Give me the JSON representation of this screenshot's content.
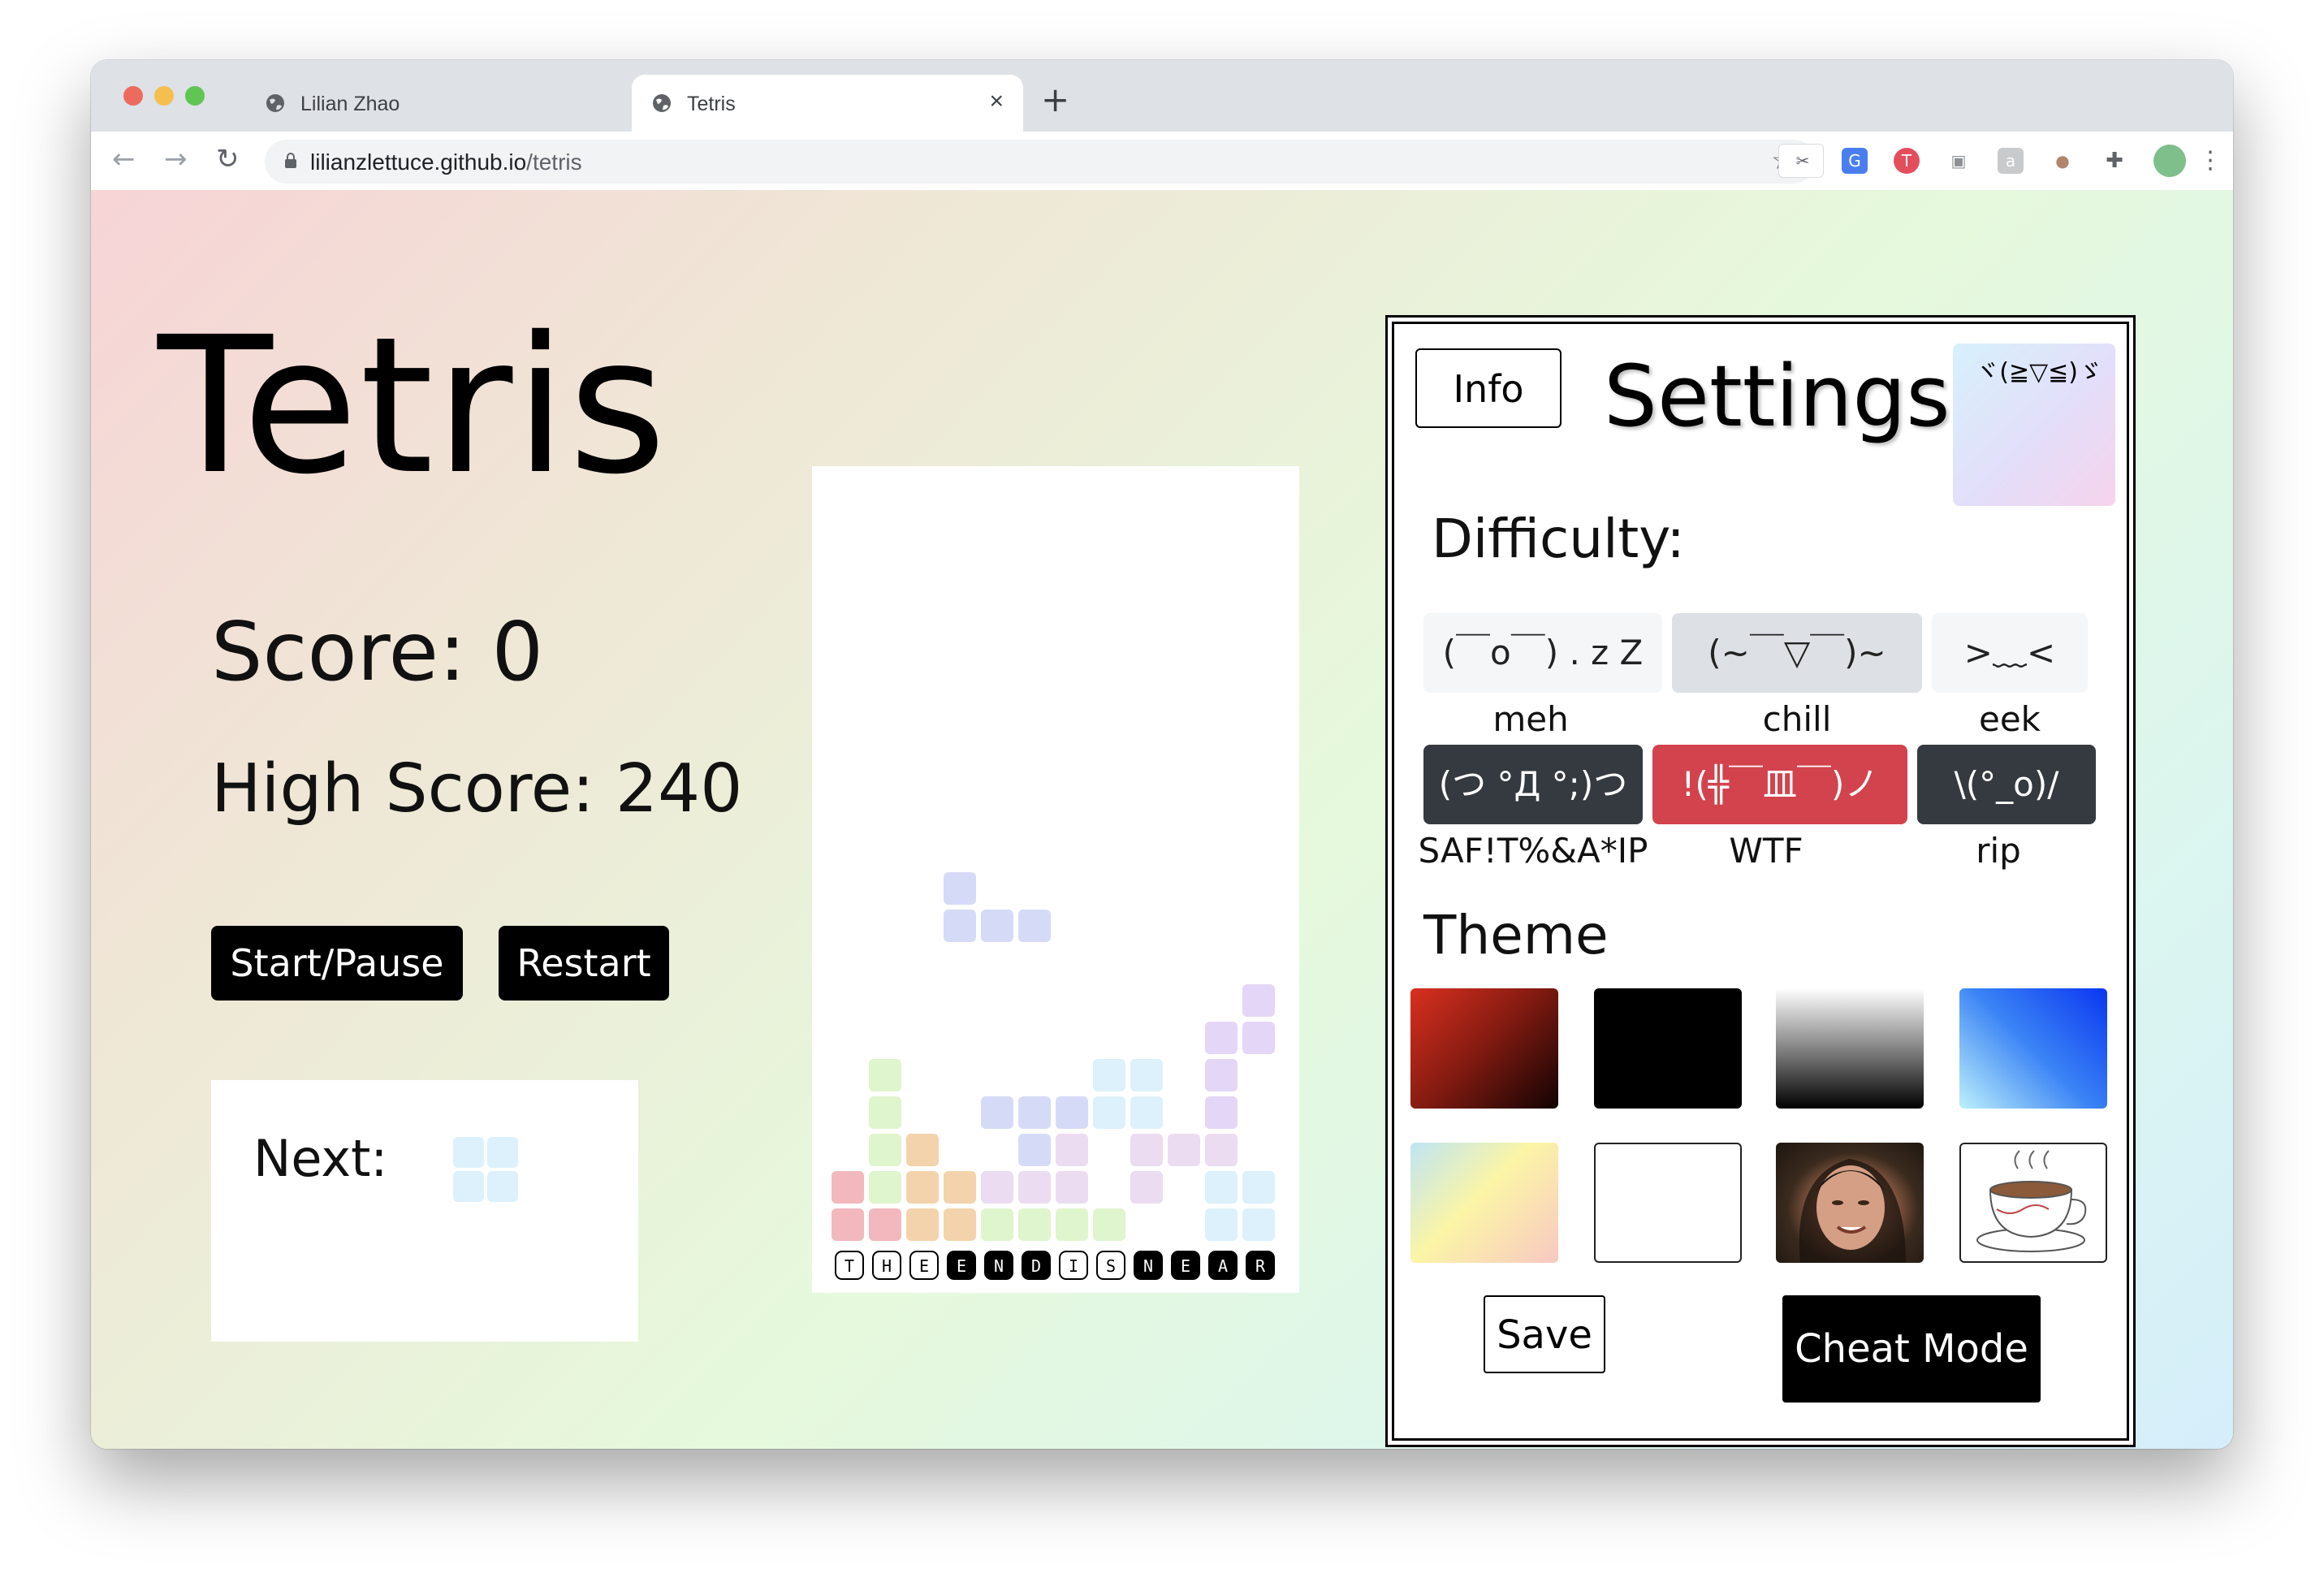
{
  "browser": {
    "tabs": [
      {
        "title": "Lilian Zhao",
        "active": false
      },
      {
        "title": "Tetris",
        "active": true
      }
    ],
    "url_host": "lilianzlettuce.github.io",
    "url_path": "/tetris"
  },
  "game": {
    "title": "Tetris",
    "score_label": "Score: 0",
    "high_score_label": "High Score: 240",
    "start_pause_label": "Start/Pause",
    "restart_label": "Restart",
    "next_label": "Next:",
    "banner_letters": [
      "T",
      "H",
      "E",
      "E",
      "N",
      "D",
      "I",
      "S",
      "N",
      "E",
      "A",
      "R"
    ]
  },
  "settings": {
    "info_label": "Info",
    "title": "Settings",
    "face": "ヾ(≧▽≦)ゞ",
    "difficulty_title": "Difficulty:",
    "difficulties": [
      {
        "face": "(￣o￣) . z Z",
        "label": "meh"
      },
      {
        "face": "(~￣▽￣)~",
        "label": "chill",
        "selected": true
      },
      {
        "face": ">﹏<",
        "label": "eek"
      },
      {
        "face": "(つ °Д °;)つ",
        "label": "SAF!T%&A*IP"
      },
      {
        "face": "!(╬￣皿￣)ノ",
        "label": "WTF"
      },
      {
        "face": "\\(°_o)/",
        "label": "rip"
      }
    ],
    "theme_title": "Theme",
    "save_label": "Save",
    "cheat_label": "Cheat Mode"
  },
  "colors": {
    "pink": "#f2b8bd",
    "green": "#dff5cd",
    "orange": "#f3d3ab",
    "blue": "#d5dbf7",
    "cyan": "#dcf1fb",
    "purple": "#e4d6f6",
    "purple2": "#ecdcf1"
  }
}
